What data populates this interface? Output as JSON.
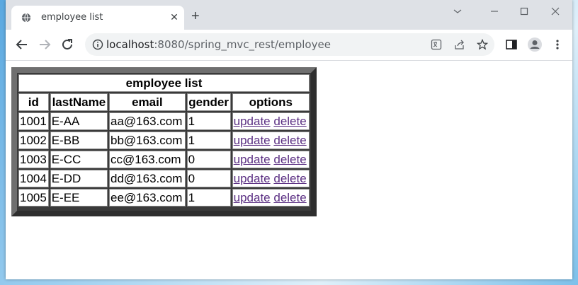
{
  "browser": {
    "tab_title": "employee list",
    "new_tab": "+",
    "url_host": "localhost",
    "url_path": ":8080/spring_mvc_rest/employee"
  },
  "table": {
    "caption": "employee list",
    "headers": [
      "id",
      "lastName",
      "email",
      "gender",
      "options"
    ],
    "rows": [
      {
        "id": "1001",
        "lastName": "E-AA",
        "email": "aa@163.com",
        "gender": "1",
        "update": "update",
        "delete": "delete"
      },
      {
        "id": "1002",
        "lastName": "E-BB",
        "email": "bb@163.com",
        "gender": "1",
        "update": "update",
        "delete": "delete"
      },
      {
        "id": "1003",
        "lastName": "E-CC",
        "email": "cc@163.com",
        "gender": "0",
        "update": "update",
        "delete": "delete"
      },
      {
        "id": "1004",
        "lastName": "E-DD",
        "email": "dd@163.com",
        "gender": "0",
        "update": "update",
        "delete": "delete"
      },
      {
        "id": "1005",
        "lastName": "E-EE",
        "email": "ee@163.com",
        "gender": "1",
        "update": "update",
        "delete": "delete"
      }
    ]
  },
  "colors": {
    "link": "#5b2f83",
    "frame": "#3a3a3a",
    "tabstrip": "#dee1e6"
  },
  "icons": [
    "globe-icon",
    "close-icon",
    "minimize-icon",
    "maximize-icon",
    "window-close-icon",
    "back-icon",
    "forward-icon",
    "reload-icon",
    "info-icon",
    "translate-icon",
    "share-icon",
    "star-icon",
    "sidebar-icon",
    "profile-icon",
    "menu-icon"
  ]
}
